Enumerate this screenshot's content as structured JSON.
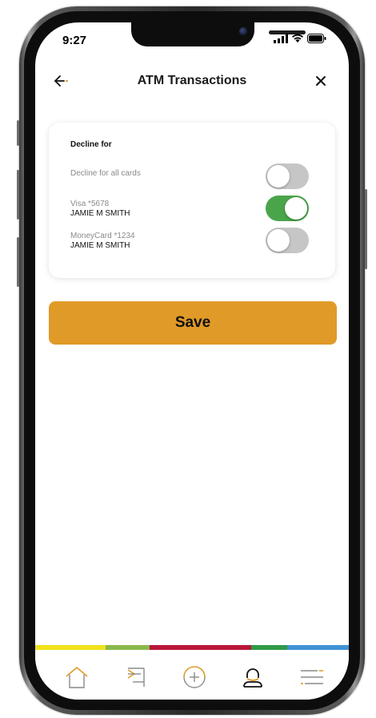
{
  "status_bar": {
    "time": "9:27"
  },
  "header": {
    "title": "ATM Transactions",
    "back_icon": "arrow-left-icon",
    "close_icon": "close-icon"
  },
  "card": {
    "title": "Decline for",
    "rows": [
      {
        "label": "Decline for all cards",
        "name": "",
        "enabled": false
      },
      {
        "label": "Visa *5678",
        "name": "JAMIE M SMITH",
        "enabled": true
      },
      {
        "label": "MoneyCard *1234",
        "name": "JAMIE M SMITH",
        "enabled": false
      }
    ]
  },
  "save_button": {
    "label": "Save"
  },
  "colors": {
    "accent": "#e09a27",
    "toggle_on": "#4aa54a",
    "toggle_off": "#c6c6c6",
    "stripe": [
      "#f0e21a",
      "#8bb84a",
      "#b8163a",
      "#2e9a47",
      "#3f93d6"
    ]
  },
  "tabbar": {
    "items": [
      {
        "icon": "home-icon"
      },
      {
        "icon": "transfer-icon"
      },
      {
        "icon": "add-circle-icon"
      },
      {
        "icon": "user-icon"
      },
      {
        "icon": "menu-icon"
      }
    ]
  }
}
